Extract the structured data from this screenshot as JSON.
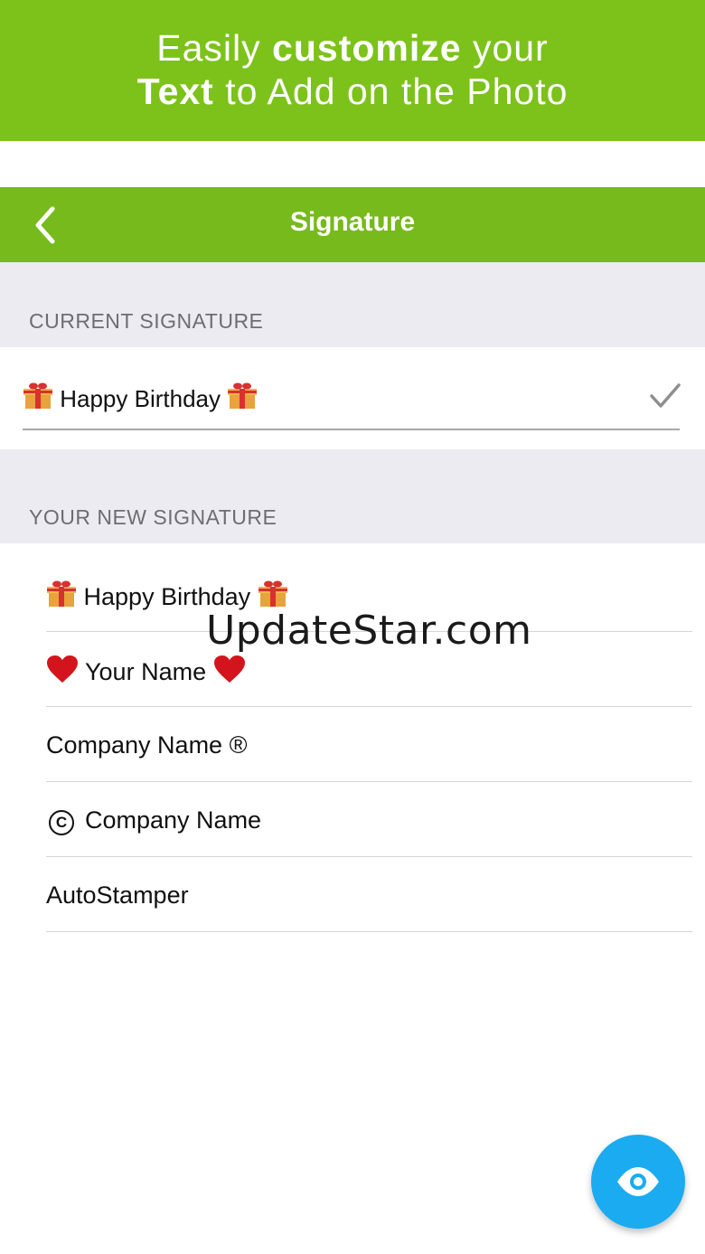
{
  "promo": {
    "line1_pre": "Easily ",
    "line1_bold": "customize",
    "line1_post": " your",
    "line2_bold": "Text",
    "line2_post": " to Add on the Photo"
  },
  "navbar": {
    "title": "Signature",
    "back_icon": "chevron-left-icon"
  },
  "current_section": {
    "header": "CURRENT SIGNATURE",
    "value": "Happy Birthday",
    "check_icon": "checkmark-icon"
  },
  "new_section": {
    "header": "YOUR NEW SIGNATURE",
    "items": [
      {
        "text": "Happy Birthday",
        "decoration": "gift"
      },
      {
        "text": "Your Name",
        "decoration": "heart"
      },
      {
        "text": "Company Name ®",
        "decoration": "none"
      },
      {
        "text": "Company Name",
        "decoration": "copyright"
      },
      {
        "text": "AutoStamper",
        "decoration": "none"
      }
    ]
  },
  "watermark": "UpdateStar.com",
  "fab": {
    "icon": "eye-icon"
  },
  "colors": {
    "promo_green": "#7cc21a",
    "nav_green": "#76ba1b",
    "section_gray": "#ebebf1",
    "fab_blue": "#1aabf0"
  }
}
